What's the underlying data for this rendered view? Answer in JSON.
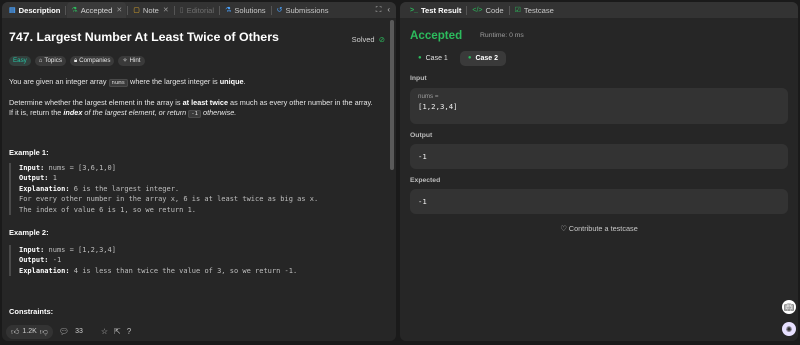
{
  "left_tabs": {
    "description": "Description",
    "accepted": "Accepted",
    "note": "Note",
    "editorial": "Editorial",
    "solutions": "Solutions",
    "submissions": "Submissions"
  },
  "problem": {
    "title": "747. Largest Number At Least Twice of Others",
    "solved": "Solved",
    "chips": [
      "Easy",
      "Topics",
      "Companies",
      "Hint"
    ],
    "p1_a": "You are given an integer array ",
    "p1_code": "nums",
    "p1_b": " where the largest integer is ",
    "p1_bold": "unique",
    "p1_end": ".",
    "p2_a": "Determine whether the largest element in the array is ",
    "p2_bold": "at least twice",
    "p2_b": " as much as every other number in the array.",
    "p3_a": "If it is, return the ",
    "p3_bold": "index",
    "p3_b": " of the largest element, or return ",
    "p3_code": "-1",
    "p3_c": " otherwise.",
    "example1_head": "Example 1:",
    "example1": {
      "input_label": "Input:",
      "input": " nums = [3,6,1,0]",
      "output_label": "Output:",
      "output": " 1",
      "explanation_label": "Explanation:",
      "explanation": " 6 is the largest integer.",
      "line2": "For every other number in the array x, 6 is at least twice as big as x.",
      "line3": "The index of value 6 is 1, so we return 1."
    },
    "example2_head": "Example 2:",
    "example2": {
      "input_label": "Input:",
      "input": " nums = [1,2,3,4]",
      "output_label": "Output:",
      "output": " -1",
      "explanation_label": "Explanation:",
      "explanation": " 4 is less than twice the value of 3, so we return -1."
    },
    "constraints": "Constraints:"
  },
  "footer": {
    "likes": "1.2K",
    "comments": "33"
  },
  "right_tabs": {
    "test_result": "Test Result",
    "code": "Code",
    "testcase": "Testcase"
  },
  "result": {
    "status": "Accepted",
    "runtime": "Runtime: 0 ms",
    "case1": "Case 1",
    "case2": "Case 2",
    "input_label": "Input",
    "input_var": "nums =",
    "input_value": "[1,2,3,4]",
    "output_label": "Output",
    "output_value": "-1",
    "expected_label": "Expected",
    "expected_value": "-1",
    "contribute": "Contribute a testcase"
  },
  "colors": {
    "accent_green": "#2cbb5d",
    "easy": "#26c6a6",
    "panel": "#262626",
    "background": "#1a1a1a"
  }
}
